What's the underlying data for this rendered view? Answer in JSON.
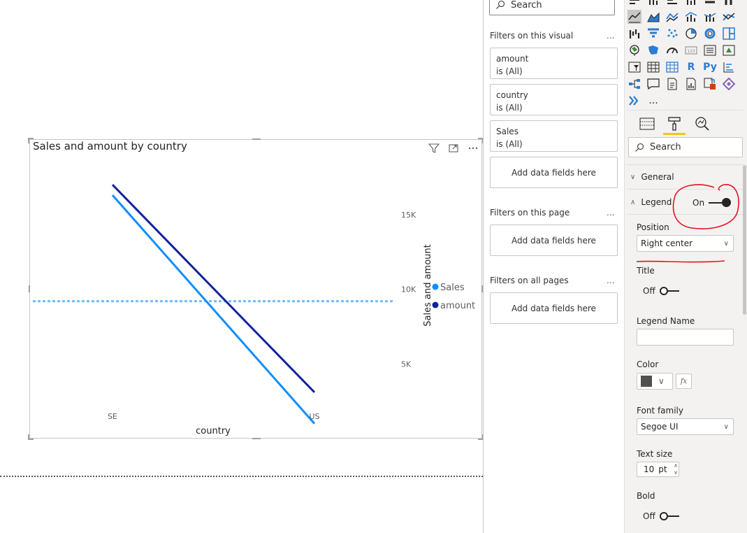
{
  "visual": {
    "title": "Sales and amount by country"
  },
  "chart_data": {
    "type": "line",
    "categories": [
      "SE",
      "US"
    ],
    "series": [
      {
        "name": "Sales",
        "values": [
          16300,
          1000
        ],
        "color": "#118dff"
      },
      {
        "name": "amount",
        "values": [
          17000,
          3100
        ],
        "color": "#12239e"
      }
    ],
    "reference_line": {
      "value": 9200,
      "color": "#70bbff",
      "style": "dotted"
    },
    "xlabel": "country",
    "ylabel": "Sales and amount",
    "y_axis_position": "right",
    "y_ticks": [
      5000,
      10000,
      15000
    ],
    "y_tick_labels": [
      "5K",
      "10K",
      "15K"
    ],
    "ylim": [
      0,
      20000
    ],
    "legend": {
      "position": "right-center",
      "entries": [
        "Sales",
        "amount"
      ]
    },
    "grid": false
  },
  "filters_pane": {
    "search_placeholder": "Search",
    "visual_section": "Filters on this visual",
    "page_section": "Filters on this page",
    "all_pages_section": "Filters on all pages",
    "more": "...",
    "cards": [
      {
        "field": "amount",
        "value": "is (All)"
      },
      {
        "field": "country",
        "value": "is (All)"
      },
      {
        "field": "Sales",
        "value": "is (All)"
      }
    ],
    "add_fields": "Add data fields here"
  },
  "viz_pane": {
    "more_visuals": "...",
    "r_visual": "R",
    "py_visual": "Py",
    "search_placeholder": "Search",
    "general": "General",
    "legend": "Legend",
    "legend_toggle": "On",
    "position_label": "Position",
    "position_value": "Right center",
    "title_label": "Title",
    "title_toggle": "Off",
    "legend_name_label": "Legend Name",
    "color_label": "Color",
    "color_value": "#505050",
    "fx": "fx",
    "font_family_label": "Font family",
    "font_family_value": "Segoe UI",
    "text_size_label": "Text size",
    "text_size_value": "10",
    "text_size_unit": "pt",
    "bold_label": "Bold",
    "bold_toggle": "Off"
  },
  "colors": {
    "accent": "#f2c811",
    "annotation": "#e81123"
  }
}
